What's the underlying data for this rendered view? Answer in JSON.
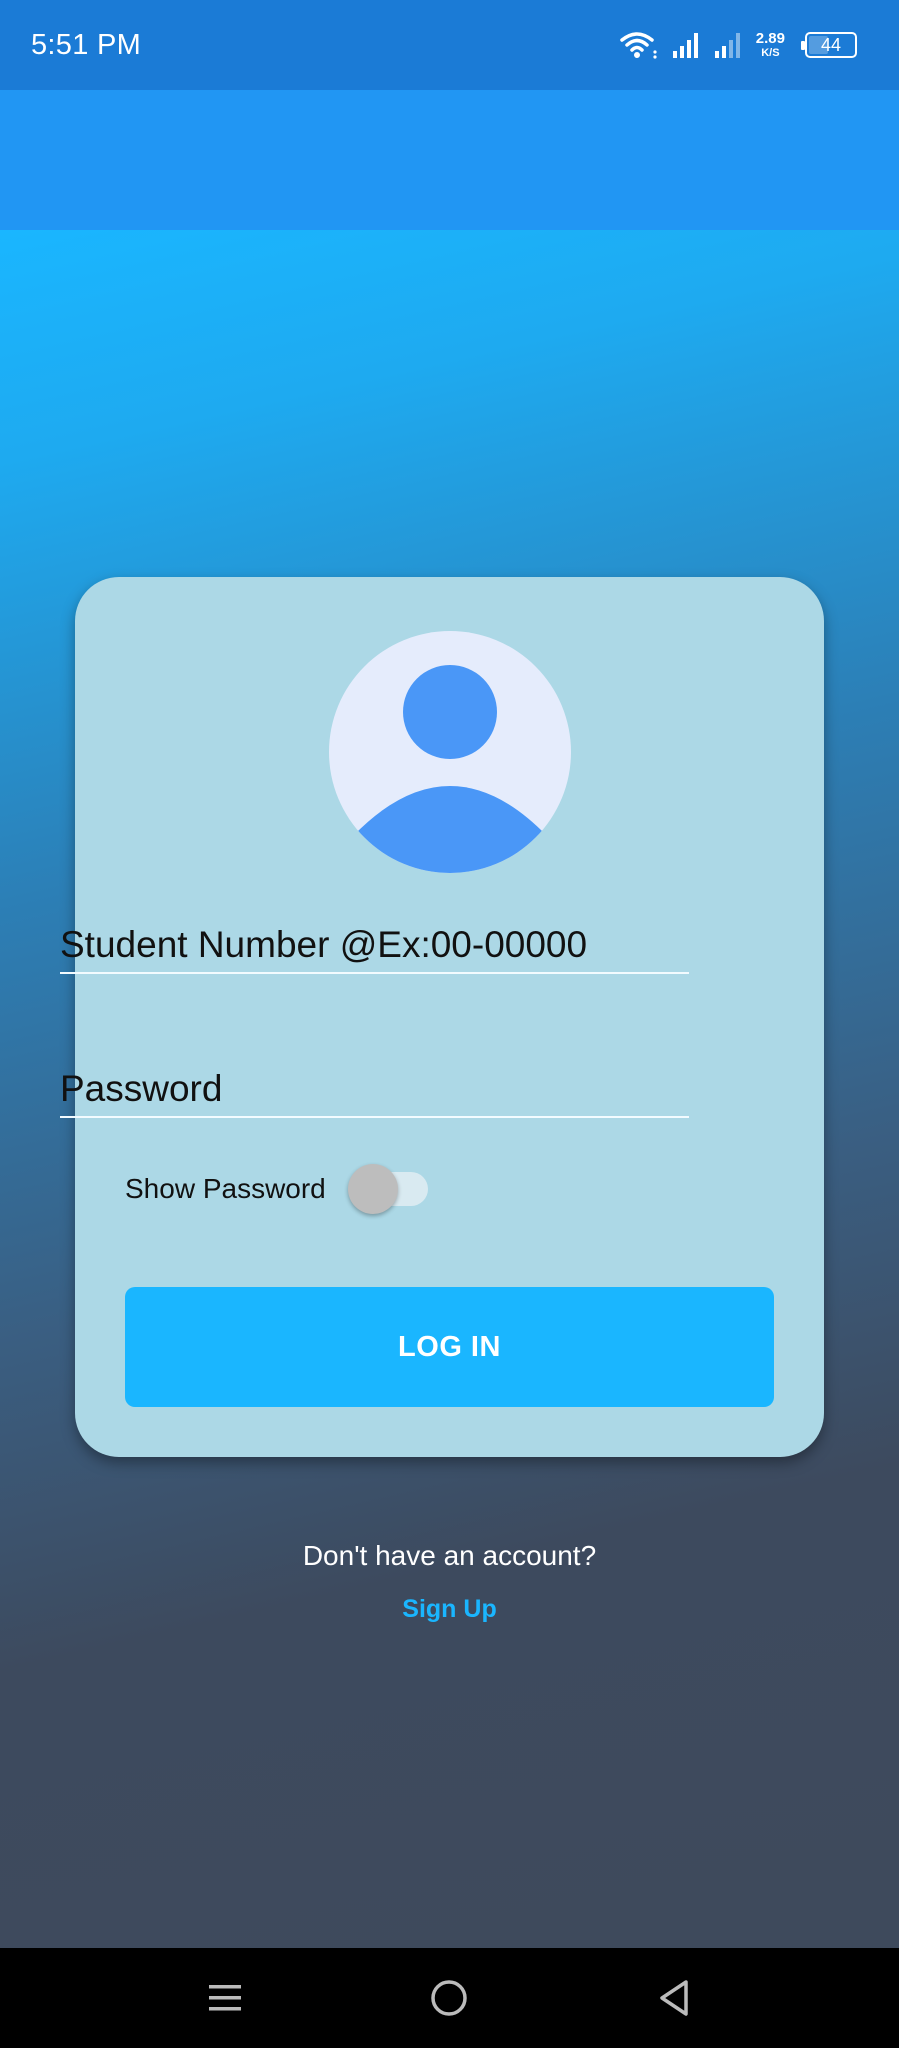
{
  "status_bar": {
    "time": "5:51 PM",
    "net_speed_value": "2.89",
    "net_speed_unit": "K/S",
    "battery_level": "44",
    "icons": [
      "wifi-icon",
      "signal-icon",
      "signal-icon-secondary",
      "battery-icon"
    ]
  },
  "login_card": {
    "avatar_icon": "user-avatar-icon",
    "student_number_placeholder": "Student Number @Ex:00-00000",
    "password_placeholder": "Password",
    "show_password_label": "Show Password",
    "show_password_enabled": false,
    "login_label": "LOG IN"
  },
  "footer": {
    "no_account_text": "Don't have an account?",
    "signup_label": "Sign Up"
  },
  "nav_bar": {
    "icons": [
      "menu-icon",
      "home-icon",
      "back-icon"
    ]
  },
  "colors": {
    "status_bar": "#1b7bd6",
    "app_bar": "#2196f3",
    "card": "#acd8e6",
    "accent": "#1ab6ff",
    "avatar": "#4a97f7"
  }
}
